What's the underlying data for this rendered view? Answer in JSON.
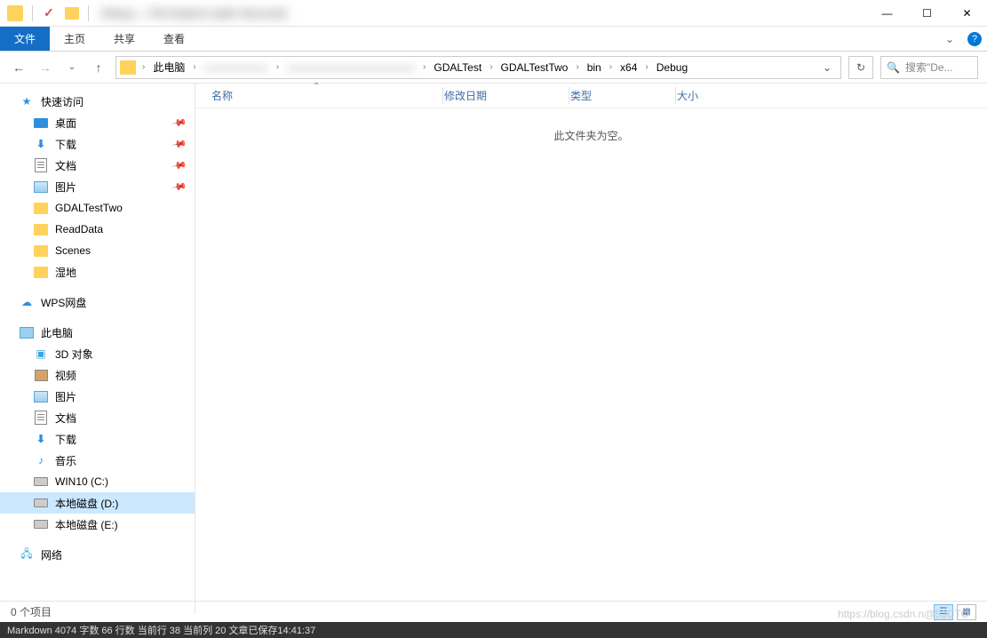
{
  "titlebar": {
    "title": "Debug — File Explorer (path obscured)"
  },
  "ribbon": {
    "file": "文件",
    "home": "主页",
    "share": "共享",
    "view": "查看",
    "help": "?"
  },
  "breadcrumb": {
    "this_pc": "此电脑",
    "hidden1": "——————",
    "hidden2": "————————————",
    "gdaltest": "GDALTest",
    "gdaltesttwo": "GDALTestTwo",
    "bin": "bin",
    "x64": "x64",
    "debug": "Debug"
  },
  "search": {
    "placeholder": "搜索\"De..."
  },
  "columns": {
    "name": "名称",
    "date": "修改日期",
    "type": "类型",
    "size": "大小"
  },
  "empty_message": "此文件夹为空。",
  "sidebar": {
    "quick_access": "快速访问",
    "desktop": "桌面",
    "downloads": "下载",
    "documents": "文档",
    "pictures": "图片",
    "gdaltesttwo": "GDALTestTwo",
    "readdata": "ReadData",
    "scenes": "Scenes",
    "wetland": "湿地",
    "wps": "WPS网盘",
    "this_pc": "此电脑",
    "objects3d": "3D 对象",
    "videos": "视频",
    "pictures2": "图片",
    "documents2": "文档",
    "downloads2": "下载",
    "music": "音乐",
    "drive_c": "WIN10 (C:)",
    "drive_d": "本地磁盘 (D:)",
    "drive_e": "本地磁盘 (E:)",
    "network": "网络"
  },
  "status": {
    "items": "0 个项目"
  },
  "watermark": "https://blog.csdn.n@51CTO",
  "devbar": "Markdown  4074 字数  66 行数  当前行 38 当前列 20  文章已保存14:41:37"
}
